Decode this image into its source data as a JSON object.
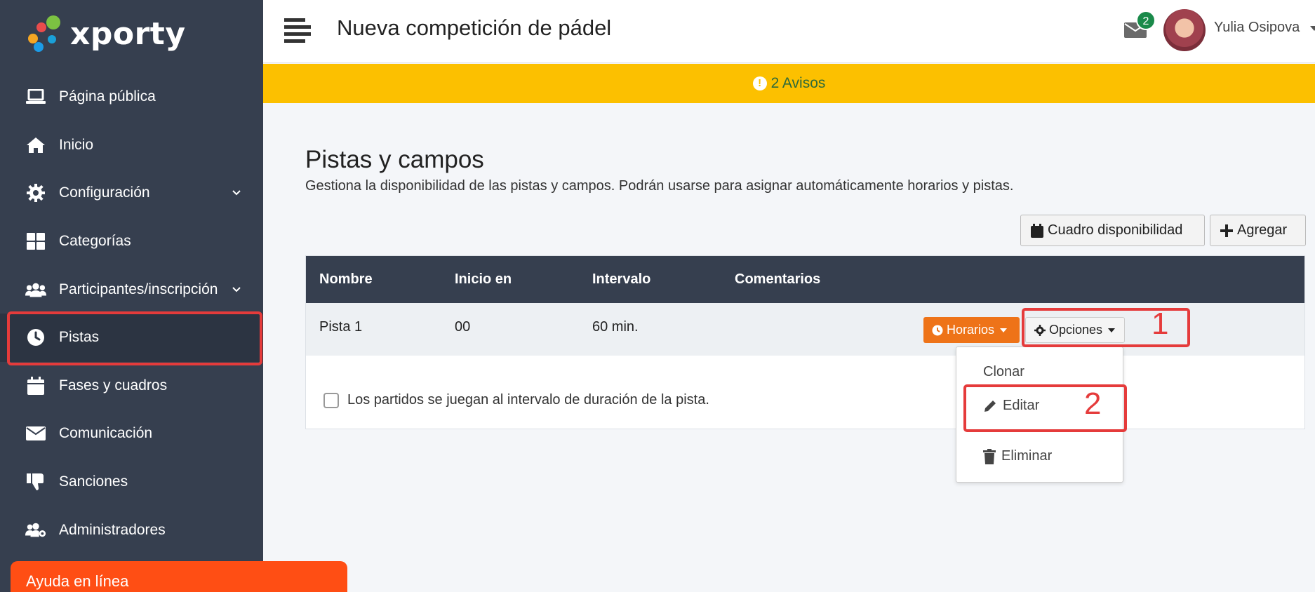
{
  "app": {
    "logo_text": "xporty"
  },
  "sidebar": {
    "items": [
      {
        "label": "Página pública",
        "icon": "laptop-icon"
      },
      {
        "label": "Inicio",
        "icon": "home-icon"
      },
      {
        "label": "Configuración",
        "icon": "gear-icon",
        "expandable": true
      },
      {
        "label": "Categorías",
        "icon": "grid-icon"
      },
      {
        "label": "Participantes/inscripción",
        "icon": "users-icon",
        "expandable": true
      },
      {
        "label": "Pistas",
        "icon": "clock-icon",
        "active": true
      },
      {
        "label": "Fases y cuadros",
        "icon": "calendar-icon"
      },
      {
        "label": "Comunicación",
        "icon": "envelope-icon"
      },
      {
        "label": "Sanciones",
        "icon": "thumbs-down-icon"
      },
      {
        "label": "Administradores",
        "icon": "users-cog-icon"
      }
    ],
    "help_label": "Ayuda en línea"
  },
  "header": {
    "title": "Nueva competición de pádel",
    "mail_count": "2",
    "user_name": "Yulia Osipova"
  },
  "alert": {
    "text": "2 Avisos"
  },
  "main": {
    "title": "Pistas y campos",
    "description": "Gestiona la disponibilidad de las pistas y campos. Podrán usarse para asignar automáticamente horarios y pistas.",
    "btn_availability": "Cuadro disponibilidad",
    "btn_add": "Agregar",
    "table": {
      "headers": [
        "Nombre",
        "Inicio en",
        "Intervalo",
        "Comentarios"
      ],
      "rows": [
        {
          "name": "Pista 1",
          "start": "00",
          "interval": "60 min.",
          "comments": ""
        }
      ],
      "btn_schedules": "Horarios",
      "btn_options": "Opciones"
    },
    "checkbox_label": "Los partidos se juegan al intervalo de duración de la pista.",
    "dropdown": {
      "clone": "Clonar",
      "edit": "Editar",
      "delete": "Eliminar"
    }
  },
  "annotations": {
    "step1": "1",
    "step2": "2"
  },
  "colors": {
    "sidebar": "#363f4f",
    "alert": "#fcc000",
    "accent_orange": "#ee7318",
    "highlight_red": "#e53b3b",
    "help": "#ff4e14"
  }
}
